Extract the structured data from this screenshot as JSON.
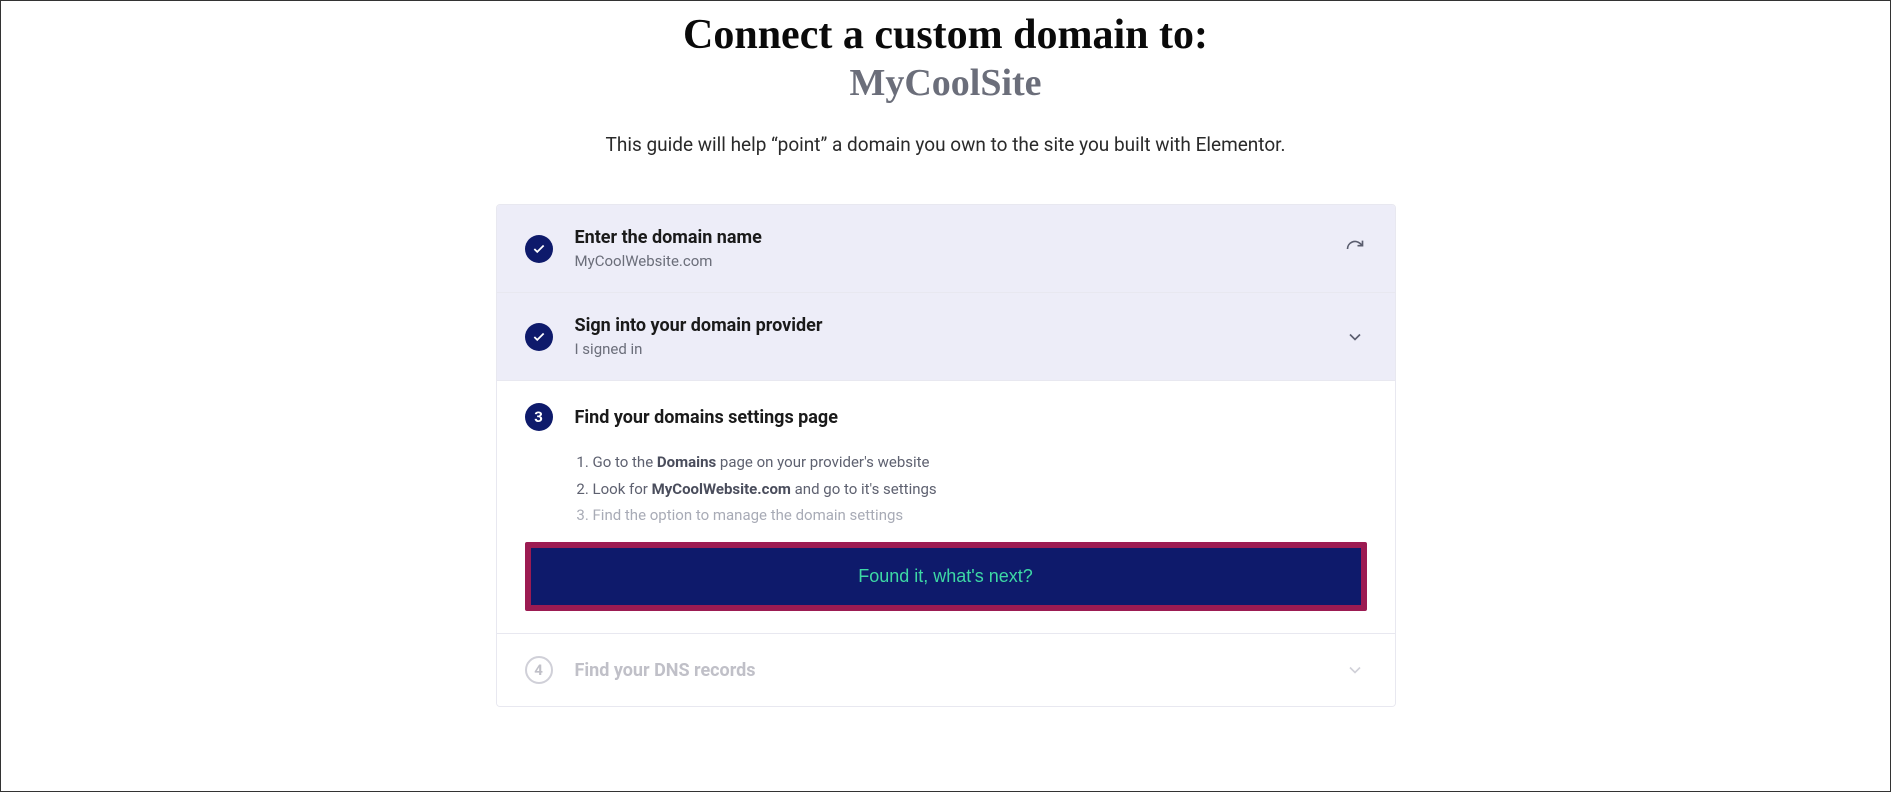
{
  "header": {
    "title_prefix": "Connect a custom domain to:",
    "site_name": "MyCoolSite",
    "subtitle": "This guide will help “point” a domain you own to the site you built with Elementor."
  },
  "steps": {
    "step1": {
      "title": "Enter the domain name",
      "value": "MyCoolWebsite.com"
    },
    "step2": {
      "title": "Sign into your domain provider",
      "value": "I signed in"
    },
    "step3": {
      "number": "3",
      "title": "Find your domains settings page",
      "item1_prefix": "Go to the ",
      "item1_bold": "Domains",
      "item1_suffix": " page on your provider's website",
      "item2_prefix": "Look for ",
      "item2_bold": "MyCoolWebsite.com",
      "item2_suffix": " and go to it's settings",
      "item3": "Find the option to manage the domain settings",
      "cta": "Found it, what's next?"
    },
    "step4": {
      "number": "4",
      "title": "Find your DNS records"
    }
  }
}
